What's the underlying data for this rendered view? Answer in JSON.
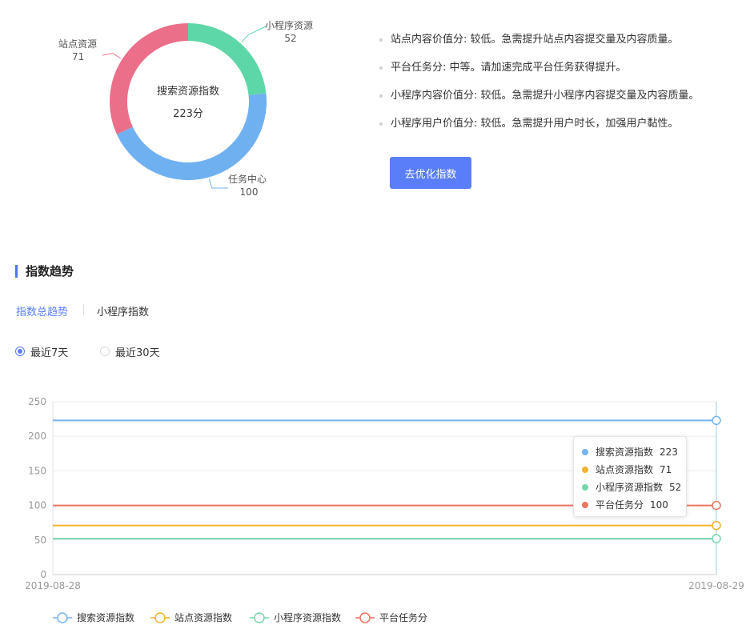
{
  "donut": {
    "center_title": "搜索资源指数",
    "center_value": "223分",
    "segments": [
      {
        "name": "小程序资源",
        "value": "52",
        "color": "#5dd7a8"
      },
      {
        "name": "任务中心",
        "value": "100",
        "color": "#6fb0f0"
      },
      {
        "name": "站点资源",
        "value": "71",
        "color": "#ec6f8a"
      }
    ]
  },
  "advice": [
    "站点内容价值分: 较低。急需提升站点内容提交量及内容质量。",
    "平台任务分: 中等。请加速完成平台任务获得提升。",
    "小程序内容价值分: 较低。急需提升小程序内容提交量及内容质量。",
    "小程序用户价值分: 较低。急需提升用户时长，加强用户黏性。"
  ],
  "optimize_button": "去优化指数",
  "section_title": "指数趋势",
  "tabs": {
    "active": "指数总趋势",
    "other": "小程序指数"
  },
  "range": {
    "opt7": "最近7天",
    "opt30": "最近30天",
    "selected": "最近7天"
  },
  "tooltip": [
    {
      "name": "搜索资源指数",
      "value": "223",
      "color": "#74b3ee"
    },
    {
      "name": "站点资源指数",
      "value": "71",
      "color": "#f2b12f"
    },
    {
      "name": "小程序资源指数",
      "value": "52",
      "color": "#76d7ac"
    },
    {
      "name": "平台任务分",
      "value": "100",
      "color": "#ec7462"
    }
  ],
  "chart_data": {
    "type": "line",
    "x": [
      "2019-08-28",
      "2019-08-29"
    ],
    "ylim": [
      0,
      250
    ],
    "yticks": [
      0,
      50,
      100,
      150,
      200,
      250
    ],
    "grid": true,
    "legend_position": "bottom",
    "series": [
      {
        "name": "搜索资源指数",
        "values": [
          223,
          223
        ],
        "color": "#74b3ee"
      },
      {
        "name": "站点资源指数",
        "values": [
          71,
          71
        ],
        "color": "#f2b12f"
      },
      {
        "name": "小程序资源指数",
        "values": [
          52,
          52
        ],
        "color": "#76d7ac"
      },
      {
        "name": "平台任务分",
        "values": [
          100,
          100
        ],
        "color": "#ec7462"
      }
    ]
  }
}
